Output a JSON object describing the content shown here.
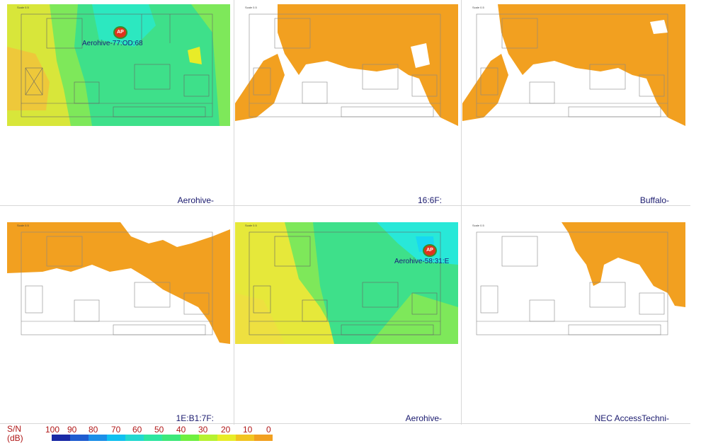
{
  "panels": [
    {
      "caption": "Aerohive-",
      "scale": "Scale 0.5",
      "ap_badge": "AP",
      "ap_label": "Aerohive-77:OD:68"
    },
    {
      "caption": "16:6F:",
      "scale": "Scale 0.5"
    },
    {
      "caption": "Buffalo-",
      "scale": "Scale 0.5"
    },
    {
      "caption": "1E:B1:7F:",
      "scale": "Scale 0.5"
    },
    {
      "caption": "Aerohive-",
      "scale": "Scale 0.5",
      "ap_badge": "AP",
      "ap_label": "Aerohive-58:31:E"
    },
    {
      "caption": "NEC AccessTechni-",
      "scale": "Scale 0.5"
    }
  ],
  "legend": {
    "title_line1": "S/N",
    "title_line2": "(dB)",
    "ticks": [
      "100",
      "90",
      "80",
      "70",
      "60",
      "50",
      "40",
      "30",
      "20",
      "10",
      "0"
    ],
    "colors": [
      "#1a2aa6",
      "#1f5cd0",
      "#1c8fe8",
      "#10c0f0",
      "#22d8d0",
      "#2ee6a0",
      "#3ee87a",
      "#6ff040",
      "#b6f230",
      "#e8ec28",
      "#f2c420",
      "#f2a020"
    ]
  },
  "heatmap_colors": {
    "orange": "#f2a020",
    "yellow": "#e6e83a",
    "green": "#2fe08a",
    "cyan": "#28e8d8"
  }
}
